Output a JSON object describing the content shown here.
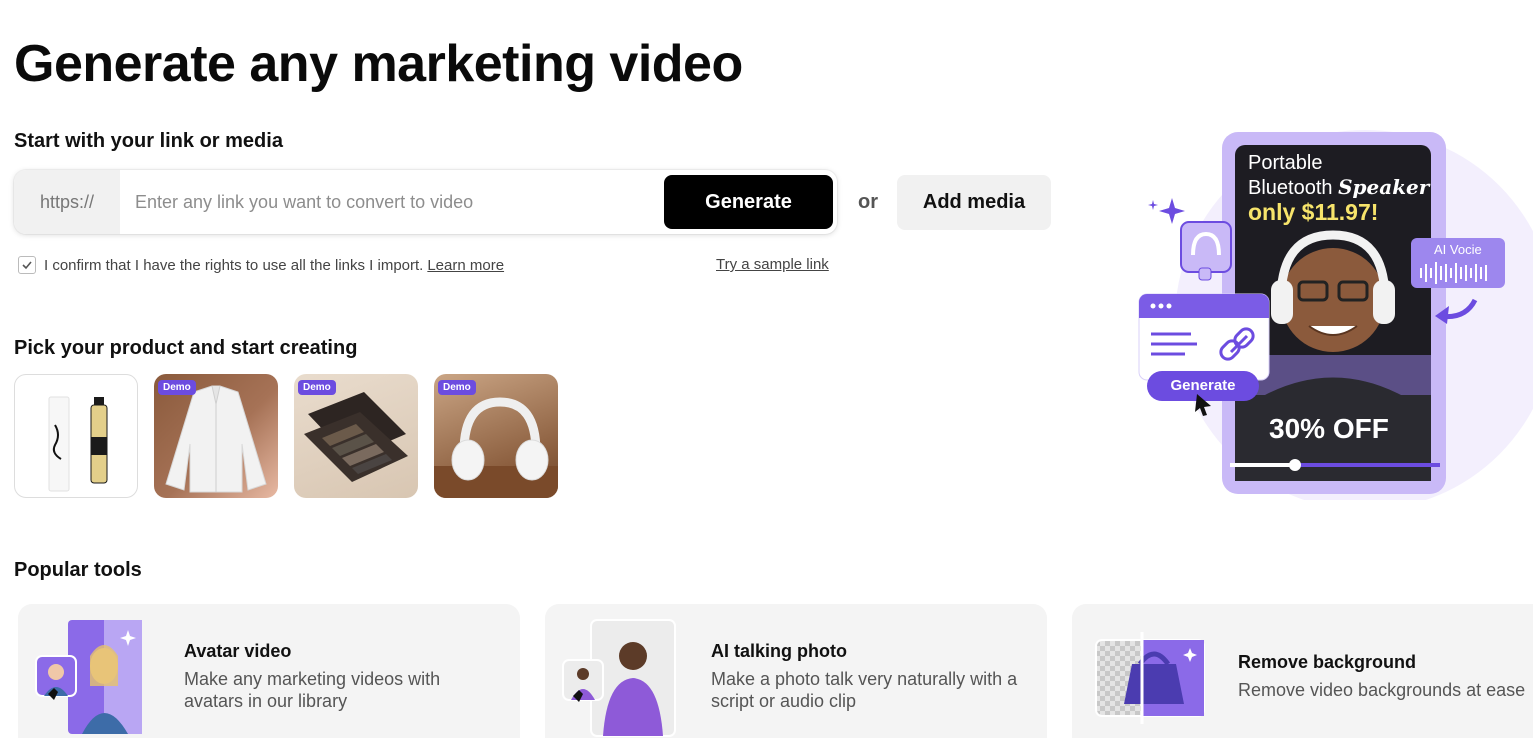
{
  "page": {
    "title": "Generate any marketing video"
  },
  "link_section": {
    "heading": "Start with your link or media",
    "prefix": "https://",
    "placeholder": "Enter any link you want to convert to video",
    "generate_label": "Generate",
    "or_label": "or",
    "add_media_label": "Add media",
    "confirm_text": "I confirm that I have the rights to use all the links I import.",
    "learn_more_label": "Learn more",
    "sample_link_label": "Try a sample link"
  },
  "products_section": {
    "heading": "Pick your product and start creating",
    "items": [
      {
        "name": "perfume",
        "badge": ""
      },
      {
        "name": "shirt",
        "badge": "Demo"
      },
      {
        "name": "eyeshadow palette",
        "badge": "Demo"
      },
      {
        "name": "headphones",
        "badge": "Demo"
      }
    ]
  },
  "hero": {
    "ad_line1": "Portable",
    "ad_line2": "Bluetooth",
    "ad_line2_italic": "Speaker",
    "ad_price": "only $11.97!",
    "ad_discount": "30% OFF",
    "voice_label": "AI Vocie",
    "generate_label": "Generate",
    "colors": {
      "accent": "#6c4ce0",
      "frame": "#c9b9f7",
      "price": "#f7e46b"
    }
  },
  "tools_section": {
    "heading": "Popular tools",
    "items": [
      {
        "title": "Avatar video",
        "desc": "Make any marketing videos with avatars in our library",
        "icon": "avatar-icon"
      },
      {
        "title": "AI talking photo",
        "desc": "Make a photo talk very naturally with a script or audio clip",
        "icon": "talking-photo-icon"
      },
      {
        "title": "Remove background",
        "desc": "Remove video backgrounds at ease",
        "icon": "remove-bg-icon"
      }
    ]
  }
}
